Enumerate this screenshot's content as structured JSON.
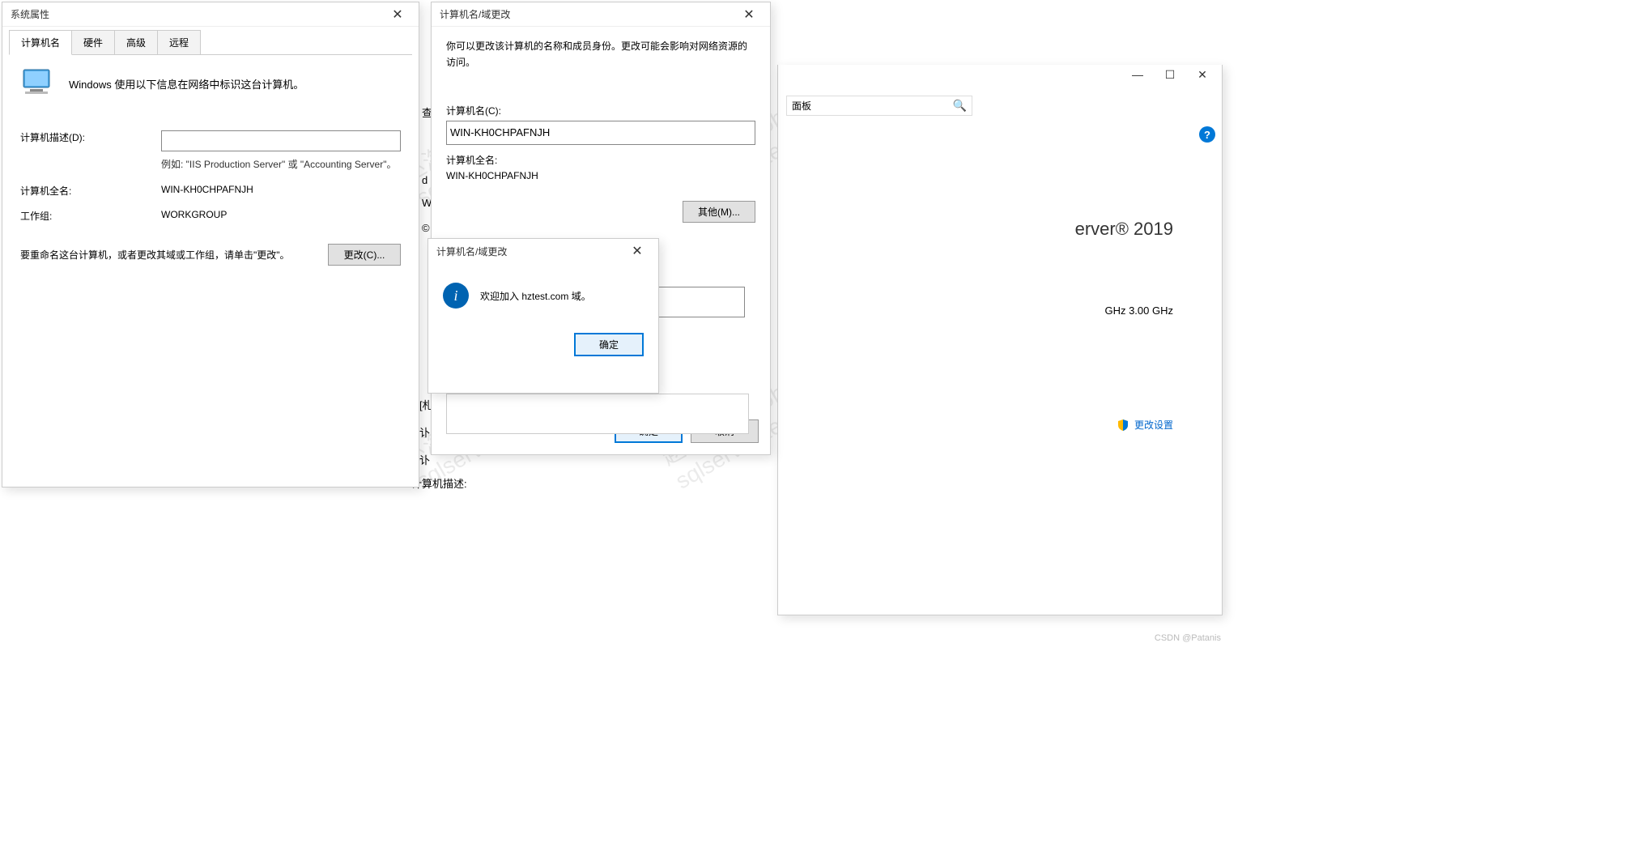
{
  "watermark_lines": [
    "赵海龙(zhaohailong)",
    "sqlserver-test-211"
  ],
  "csdn_credit": "CSDN @Patanis",
  "sys_props": {
    "title": "系统属性",
    "tabs": {
      "computer_name": "计算机名",
      "hardware": "硬件",
      "advanced": "高级",
      "remote": "远程"
    },
    "intro": "Windows 使用以下信息在网络中标识这台计算机。",
    "desc_label": "计算机描述(D):",
    "desc_value": "",
    "desc_hint": "例如: \"IIS Production Server\" 或 \"Accounting Server\"。",
    "fullname_label": "计算机全名:",
    "fullname_value": "WIN-KH0CHPAFNJH",
    "workgroup_label": "工作组:",
    "workgroup_value": "WORKGROUP",
    "rename_text": "要重命名这台计算机，或者更改其域或工作组，请单击\"更改\"。",
    "change_btn": "更改(C)..."
  },
  "domain_change": {
    "title": "计算机名/域更改",
    "intro": "你可以更改该计算机的名称和成员身份。更改可能会影响对网络资源的访问。",
    "computer_name_label": "计算机名(C):",
    "computer_name_value": "WIN-KH0CHPAFNJH",
    "fullname_label": "计算机全名:",
    "fullname_value": "WIN-KH0CHPAFNJH",
    "more_btn": "其他(M)...",
    "ok_btn": "确定",
    "cancel_btn": "取消"
  },
  "msgbox": {
    "title": "计算机名/域更改",
    "message": "欢迎加入 hztest.com 域。",
    "ok_btn": "确定"
  },
  "background": {
    "server_text": "erver® 2019",
    "ghz_text": "GHz   3.00 GHz",
    "change_settings": "更改设置",
    "panel_text": "面板",
    "partial_labels": {
      "e": "查",
      "d": "d",
      "w": "W",
      "c": "©",
      "br1": "[札",
      "yi": "讣",
      "yi2": "讣",
      "desc": "计算机描述:"
    }
  }
}
